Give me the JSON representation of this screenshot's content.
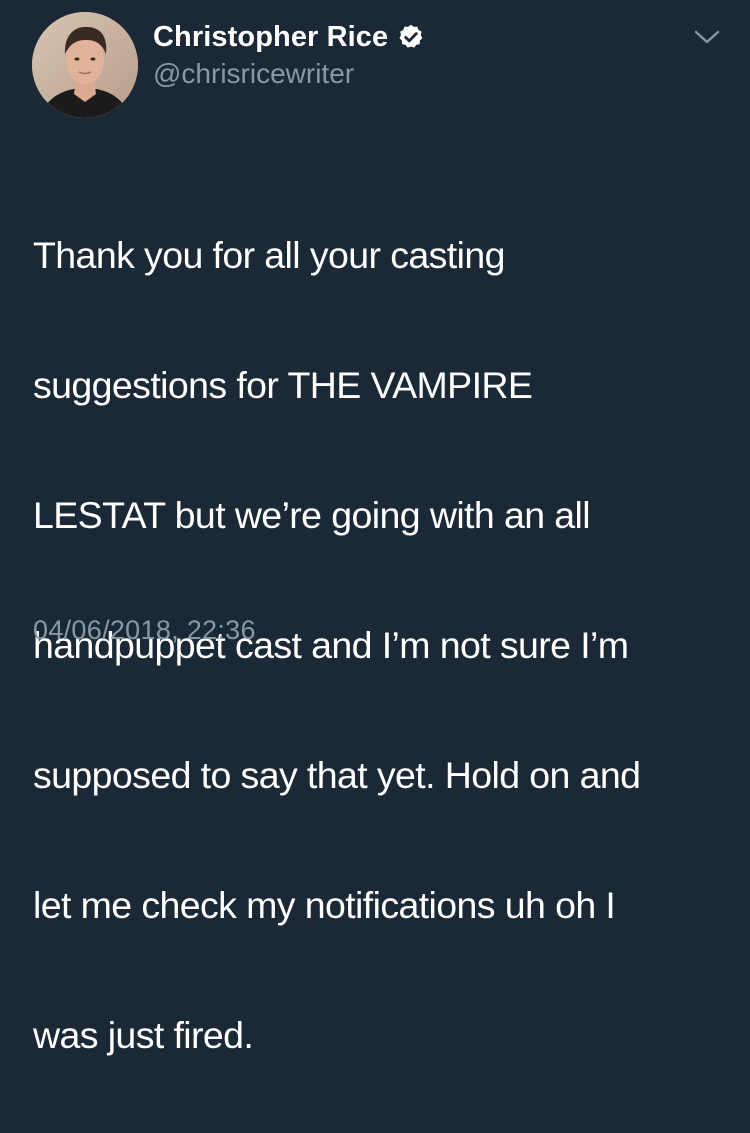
{
  "tweet": {
    "author": {
      "display_name": "Christopher Rice",
      "handle": "@chrisricewriter",
      "verified_icon": "verified-badge-icon"
    },
    "text_lines": [
      "Thank you for all your casting",
      "suggestions for THE VAMPIRE",
      "LESTAT but we’re going with an all",
      "handpuppet cast and I’m not sure I’m",
      "supposed to say that yet. Hold on and",
      "let me check my notifications uh oh I",
      "was just fired."
    ],
    "timestamp": "04/06/2018, 22:36",
    "menu_icon": "chevron-down-icon"
  },
  "colors": {
    "background": "#1b2836",
    "primary_text": "#ffffff",
    "secondary_text": "#8899a6"
  }
}
